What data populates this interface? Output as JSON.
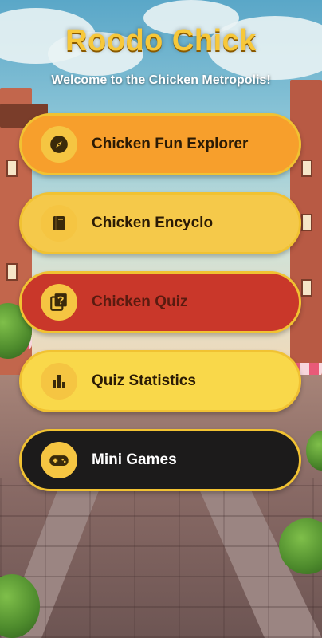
{
  "header": {
    "title": "Roodo Chick",
    "subtitle": "Welcome to the Chicken Metropolis!"
  },
  "menu": [
    {
      "label": "Chicken Fun Explorer",
      "icon": "compass-icon",
      "color": "#f79f2c"
    },
    {
      "label": "Chicken Encyclo",
      "icon": "book-icon",
      "color": "#f5c94a"
    },
    {
      "label": "Chicken Quiz",
      "icon": "quiz-icon",
      "color": "#c9372a"
    },
    {
      "label": "Quiz Statistics",
      "icon": "bar-chart-icon",
      "color": "#f9d84a"
    },
    {
      "label": "Mini Games",
      "icon": "gamepad-icon",
      "color": "#1c1b1b"
    }
  ],
  "theme": {
    "title_color": "#f7c83a",
    "button_border": "#f1c232",
    "icon_circle": "#f5c542"
  }
}
